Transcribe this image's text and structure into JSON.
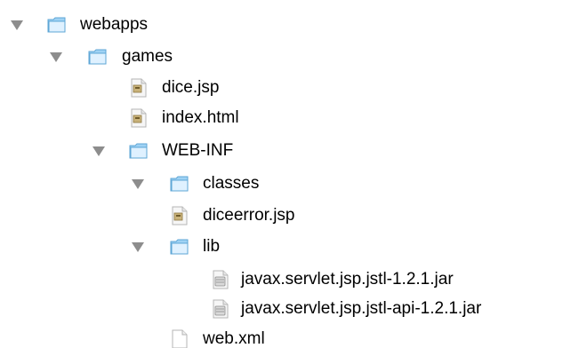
{
  "tree": {
    "items": [
      {
        "label": "webapps",
        "kind": "folder",
        "expanded": true,
        "icon": "folder-icon"
      },
      {
        "label": "games",
        "kind": "folder",
        "expanded": true,
        "icon": "folder-icon"
      },
      {
        "label": "dice.jsp",
        "kind": "jsp",
        "icon": "jsp-file-icon"
      },
      {
        "label": "index.html",
        "kind": "html",
        "icon": "html-file-icon"
      },
      {
        "label": "WEB-INF",
        "kind": "folder",
        "expanded": true,
        "icon": "folder-icon"
      },
      {
        "label": "classes",
        "kind": "folder",
        "expanded": true,
        "icon": "folder-icon"
      },
      {
        "label": "diceerror.jsp",
        "kind": "jsp",
        "icon": "jsp-file-icon"
      },
      {
        "label": "lib",
        "kind": "folder",
        "expanded": true,
        "icon": "folder-icon"
      },
      {
        "label": "javax.servlet.jsp.jstl-1.2.1.jar",
        "kind": "jar",
        "icon": "jar-file-icon"
      },
      {
        "label": "javax.servlet.jsp.jstl-api-1.2.1.jar",
        "kind": "jar",
        "icon": "jar-file-icon"
      },
      {
        "label": "web.xml",
        "kind": "xml",
        "icon": "document-icon"
      }
    ]
  },
  "colors": {
    "folder_light": "#dff1ff",
    "folder_mid": "#9fd2f4",
    "folder_border": "#5ea6d6",
    "disclosure": "#8d8d8d",
    "file_paper": "#f6f6f6",
    "file_border": "#b5b5b5"
  }
}
